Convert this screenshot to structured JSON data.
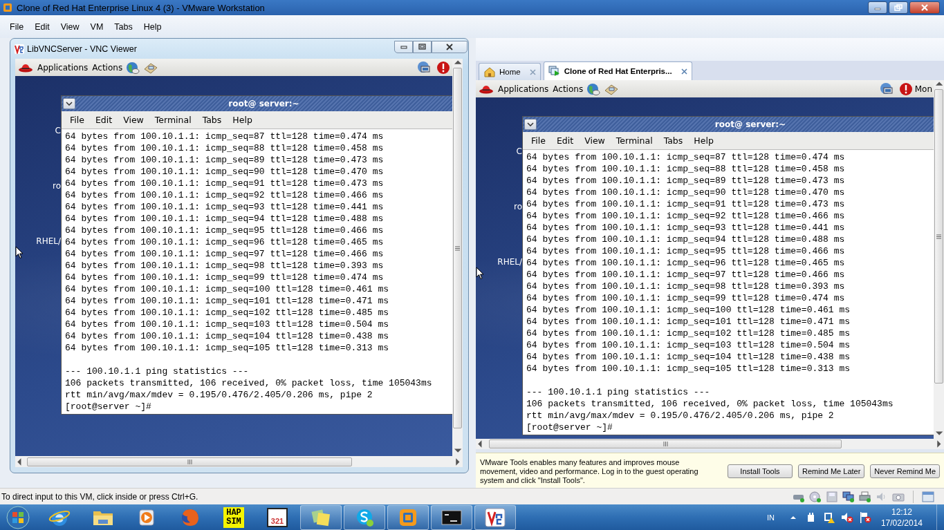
{
  "window": {
    "title": "Clone of Red Hat Enterprise Linux 4 (3) - VMware Workstation"
  },
  "menu": [
    "File",
    "Edit",
    "View",
    "VM",
    "Tabs",
    "Help"
  ],
  "vnc_window": {
    "title": "LibVNCServer - VNC Viewer",
    "guest": {
      "panel": {
        "menus": [
          "Applications",
          "Actions"
        ]
      },
      "desktop_labels": [
        "C",
        "ro",
        "RHEL/"
      ],
      "terminal": {
        "title": "root@ server:~",
        "menu": [
          "File",
          "Edit",
          "View",
          "Terminal",
          "Tabs",
          "Help"
        ],
        "lines": [
          "64 bytes from 100.10.1.1: icmp_seq=87 ttl=128 time=0.474 ms",
          "64 bytes from 100.10.1.1: icmp_seq=88 ttl=128 time=0.458 ms",
          "64 bytes from 100.10.1.1: icmp_seq=89 ttl=128 time=0.473 ms",
          "64 bytes from 100.10.1.1: icmp_seq=90 ttl=128 time=0.470 ms",
          "64 bytes from 100.10.1.1: icmp_seq=91 ttl=128 time=0.473 ms",
          "64 bytes from 100.10.1.1: icmp_seq=92 ttl=128 time=0.466 ms",
          "64 bytes from 100.10.1.1: icmp_seq=93 ttl=128 time=0.441 ms",
          "64 bytes from 100.10.1.1: icmp_seq=94 ttl=128 time=0.488 ms",
          "64 bytes from 100.10.1.1: icmp_seq=95 ttl=128 time=0.466 ms",
          "64 bytes from 100.10.1.1: icmp_seq=96 ttl=128 time=0.465 ms",
          "64 bytes from 100.10.1.1: icmp_seq=97 ttl=128 time=0.466 ms",
          "64 bytes from 100.10.1.1: icmp_seq=98 ttl=128 time=0.393 ms",
          "64 bytes from 100.10.1.1: icmp_seq=99 ttl=128 time=0.474 ms",
          "64 bytes from 100.10.1.1: icmp_seq=100 ttl=128 time=0.461 ms",
          "64 bytes from 100.10.1.1: icmp_seq=101 ttl=128 time=0.471 ms",
          "64 bytes from 100.10.1.1: icmp_seq=102 ttl=128 time=0.485 ms",
          "64 bytes from 100.10.1.1: icmp_seq=103 ttl=128 time=0.504 ms",
          "64 bytes from 100.10.1.1: icmp_seq=104 ttl=128 time=0.438 ms",
          "64 bytes from 100.10.1.1: icmp_seq=105 ttl=128 time=0.313 ms"
        ],
        "statistics": [
          "--- 100.10.1.1 ping statistics ---",
          "106 packets transmitted, 106 received, 0% packet loss, time 105043ms",
          "rtt min/avg/max/mdev = 0.195/0.476/2.405/0.206 ms, pipe 2",
          "[root@server ~]#"
        ]
      }
    }
  },
  "tabs": [
    {
      "label": "Home",
      "selected": false
    },
    {
      "label": "Clone of Red Hat Enterpris...",
      "selected": true
    }
  ],
  "vm_view": {
    "guest": {
      "panel": {
        "menus": [
          "Applications",
          "Actions"
        ],
        "extra": "Mon"
      },
      "desktop_labels": [
        "C",
        "ro",
        "RHEL/"
      ],
      "terminal": {
        "title": "root@ server:~",
        "menu": [
          "File",
          "Edit",
          "View",
          "Terminal",
          "Tabs",
          "Help"
        ],
        "lines": [
          "64 bytes from 100.10.1.1: icmp_seq=87 ttl=128 time=0.474 ms",
          "64 bytes from 100.10.1.1: icmp_seq=88 ttl=128 time=0.458 ms",
          "64 bytes from 100.10.1.1: icmp_seq=89 ttl=128 time=0.473 ms",
          "64 bytes from 100.10.1.1: icmp_seq=90 ttl=128 time=0.470 ms",
          "64 bytes from 100.10.1.1: icmp_seq=91 ttl=128 time=0.473 ms",
          "64 bytes from 100.10.1.1: icmp_seq=92 ttl=128 time=0.466 ms",
          "64 bytes from 100.10.1.1: icmp_seq=93 ttl=128 time=0.441 ms",
          "64 bytes from 100.10.1.1: icmp_seq=94 ttl=128 time=0.488 ms",
          "64 bytes from 100.10.1.1: icmp_seq=95 ttl=128 time=0.466 ms",
          "64 bytes from 100.10.1.1: icmp_seq=96 ttl=128 time=0.465 ms",
          "64 bytes from 100.10.1.1: icmp_seq=97 ttl=128 time=0.466 ms",
          "64 bytes from 100.10.1.1: icmp_seq=98 ttl=128 time=0.393 ms",
          "64 bytes from 100.10.1.1: icmp_seq=99 ttl=128 time=0.474 ms",
          "64 bytes from 100.10.1.1: icmp_seq=100 ttl=128 time=0.461 ms",
          "64 bytes from 100.10.1.1: icmp_seq=101 ttl=128 time=0.471 ms",
          "64 bytes from 100.10.1.1: icmp_seq=102 ttl=128 time=0.485 ms",
          "64 bytes from 100.10.1.1: icmp_seq=103 ttl=128 time=0.504 ms",
          "64 bytes from 100.10.1.1: icmp_seq=104 ttl=128 time=0.438 ms",
          "64 bytes from 100.10.1.1: icmp_seq=105 ttl=128 time=0.313 ms"
        ],
        "statistics": [
          "--- 100.10.1.1 ping statistics ---",
          "106 packets transmitted, 106 received, 0% packet loss, time 105043ms",
          "rtt min/avg/max/mdev = 0.195/0.476/2.405/0.206 ms, pipe 2",
          "[root@server ~]#"
        ]
      }
    }
  },
  "message_bar": {
    "text": "VMware Tools enables many features and improves mouse movement, video and performance. Log in to the guest operating system and click \"Install Tools\".",
    "buttons": [
      "Install Tools",
      "Remind Me Later",
      "Never Remind Me"
    ]
  },
  "status_bar": {
    "text": "To direct input to this VM, click inside or press Ctrl+G."
  },
  "taskbar": {
    "items": [
      {
        "kind": "ie",
        "running": false
      },
      {
        "kind": "folder",
        "running": false
      },
      {
        "kind": "player",
        "running": false
      },
      {
        "kind": "firefox",
        "running": false
      },
      {
        "kind": "hapsim",
        "running": false,
        "text": [
          "HAP",
          "SIM"
        ]
      },
      {
        "kind": "clapper",
        "running": false,
        "text": [
          "321"
        ]
      },
      {
        "kind": "notes",
        "running": true
      },
      {
        "kind": "skype",
        "running": true
      },
      {
        "kind": "vmware",
        "running": true
      },
      {
        "kind": "console",
        "running": true
      },
      {
        "kind": "vnc",
        "running": true
      }
    ],
    "language": "IN",
    "clock": {
      "time": "12:12",
      "date": "17/02/2014"
    }
  }
}
